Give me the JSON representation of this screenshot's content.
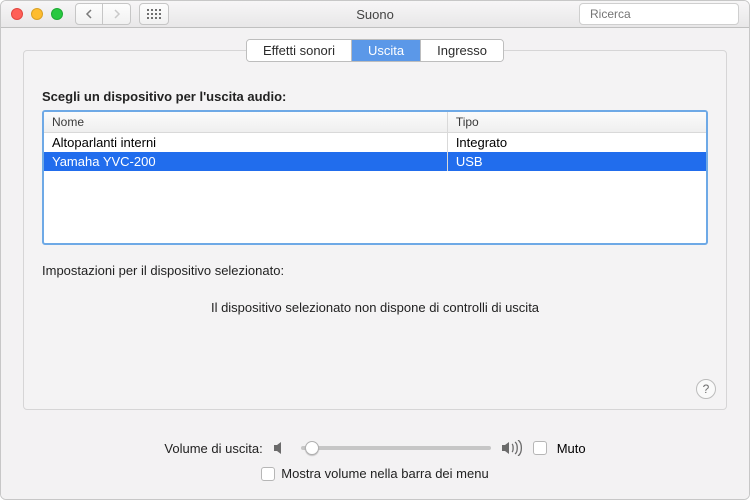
{
  "window": {
    "title": "Suono"
  },
  "toolbar": {
    "search_placeholder": "Ricerca"
  },
  "tabs": {
    "effects": "Effetti sonori",
    "output": "Uscita",
    "input": "Ingresso"
  },
  "output_label": "Scegli un dispositivo per l'uscita audio:",
  "table": {
    "header": {
      "name": "Nome",
      "type": "Tipo"
    },
    "rows": [
      {
        "name": "Altoparlanti interni",
        "type": "Integrato"
      },
      {
        "name": "Yamaha YVC-200",
        "type": "USB"
      }
    ]
  },
  "settings_label": "Impostazioni per il dispositivo selezionato:",
  "no_controls": "Il dispositivo selezionato non dispone di controlli di uscita",
  "volume": {
    "label": "Volume di uscita:",
    "mute": "Muto"
  },
  "showmenu": "Mostra volume nella barra dei menu",
  "help_symbol": "?"
}
